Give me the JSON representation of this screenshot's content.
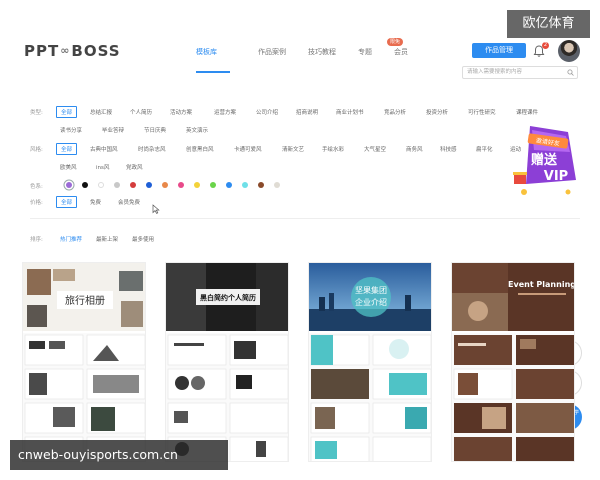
{
  "watermarks": {
    "top_right": "欧亿体育",
    "bottom_left": "cnweb-ouyisports.com.cn"
  },
  "header": {
    "logo_left": "PPT",
    "logo_right": "BOSS",
    "nav": [
      {
        "label": "模板库",
        "active": true
      },
      {
        "label": "作品案例",
        "active": false
      },
      {
        "label": "技巧教程",
        "active": false
      },
      {
        "label": "专题",
        "active": false
      },
      {
        "label": "会员",
        "active": false
      }
    ],
    "nav_badge": "限免",
    "manage_button": "作品管理",
    "bell_count": "2"
  },
  "search": {
    "placeholder": "请输入需要搜索的内容"
  },
  "filters": {
    "type_label": "类型:",
    "type_options": [
      "全部",
      "总结汇报",
      "个人简历",
      "活动方案",
      "运营方案",
      "公司介绍",
      "招商说明",
      "商业计划书",
      "竞品分析",
      "投资分析",
      "可行性研究",
      "课程课件"
    ],
    "type_options_row2": [
      "读书分享",
      "毕业答辩",
      "节日庆典",
      "英文演示"
    ],
    "style_label": "风格:",
    "style_options": [
      "全部",
      "古典中国风",
      "时尚杂志风",
      "创意黑白风",
      "卡通可爱风",
      "清新文艺",
      "手绘水彩",
      "大气星空",
      "商务风",
      "科技感",
      "扁平化",
      "运动"
    ],
    "style_options_row2": [
      "欧美风",
      "ins风",
      "党政风"
    ],
    "color_label": "色系:",
    "colors": [
      "#9b6bd6",
      "#111111",
      "#ffffff",
      "#c8c8c8",
      "#d43d3d",
      "#1f5fd6",
      "#e8884a",
      "#e84a8a",
      "#f3d23a",
      "#6ad44a",
      "#2d8cf0",
      "#6fe0e8",
      "#8a4a2a",
      "#e0dcd4"
    ],
    "price_label": "价格:",
    "price_options": [
      "全部",
      "免费",
      "会员免费"
    ],
    "sort_label": "排序:",
    "sort_options": [
      "热门推荐",
      "最新上架",
      "最多使用"
    ]
  },
  "vip_banner": {
    "ribbon": "邀请好友",
    "big": "赠送",
    "vip": "VIP"
  },
  "side_tools": {
    "teach": "新手教学"
  },
  "cards": [
    {
      "title": "旅行相册"
    },
    {
      "title": "黑白简约个人简历"
    },
    {
      "title": "坚果集团",
      "subtitle": "企业介绍"
    },
    {
      "title": "Event Planning"
    }
  ]
}
